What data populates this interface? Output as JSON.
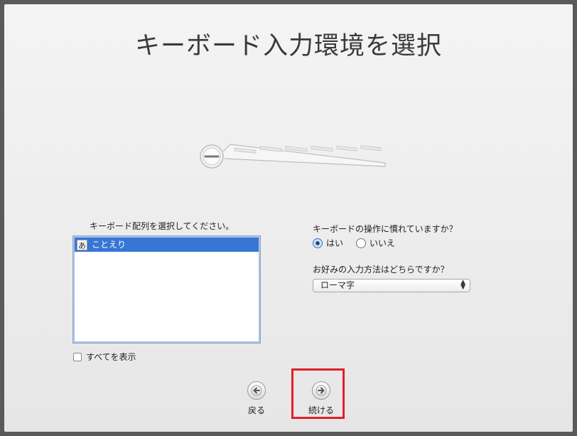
{
  "page": {
    "title": "キーボード入力環境を選択"
  },
  "layout_selector": {
    "label": "キーボード配列を選択してください。",
    "items": [
      {
        "badge": "あ",
        "label": "ことえり",
        "selected": true
      }
    ],
    "show_all_label": "すべてを表示",
    "show_all_checked": false
  },
  "keyboard_familiarity": {
    "question": "キーボードの操作に慣れていますか？",
    "options": [
      {
        "label": "はい",
        "selected": true
      },
      {
        "label": "いいえ",
        "selected": false
      }
    ]
  },
  "input_method": {
    "question": "お好みの入力方法はどちらですか？",
    "selected_value": "ローマ字"
  },
  "navigation": {
    "back_label": "戻る",
    "continue_label": "続ける"
  },
  "colors": {
    "selection": "#3876d6",
    "highlight": "#e0202a"
  },
  "icons": {
    "back": "arrow-left-icon",
    "continue": "arrow-right-icon"
  }
}
